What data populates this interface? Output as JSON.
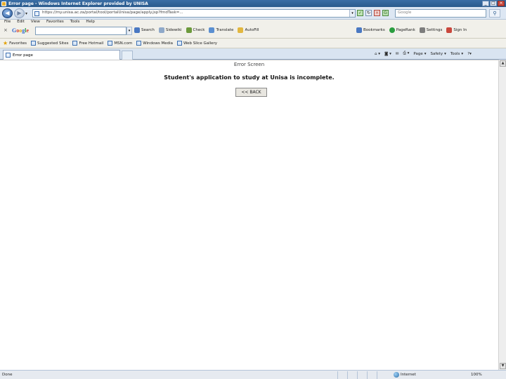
{
  "window": {
    "title": "Error page - Windows Internet Explorer provided by UNISA",
    "controls": [
      "_",
      "□",
      "×"
    ]
  },
  "address_bar": {
    "url": "https://my.unisa.ac.za/portal/tool/portalUnisa/page/apply.jsp?fmdTask=...",
    "search_placeholder": "Google"
  },
  "menu": {
    "items": [
      "File",
      "Edit",
      "View",
      "Favorites",
      "Tools",
      "Help"
    ]
  },
  "google_toolbar": {
    "logo": "Google",
    "items": [
      "Search",
      "Sidewiki",
      "Check",
      "Translate",
      "AutoFill"
    ],
    "right_items": [
      "Bookmarks",
      "PageRank",
      "Settings",
      "Sign In"
    ]
  },
  "links_bar": {
    "favorites_label": "Favorites",
    "items": [
      "Suggested Sites",
      "Free Hotmail",
      "MSN.com",
      "Windows Media",
      "Web Slice Gallery"
    ]
  },
  "tabs": {
    "active_label": "Error page",
    "tools": [
      "Page",
      "Safety",
      "Tools"
    ]
  },
  "page": {
    "screen_title": "Error Screen",
    "message": "Student's application to study at Unisa is incomplete.",
    "back_button": "<< BACK"
  },
  "status": {
    "text": "Done",
    "zone": "Internet",
    "zoom": "100%"
  }
}
